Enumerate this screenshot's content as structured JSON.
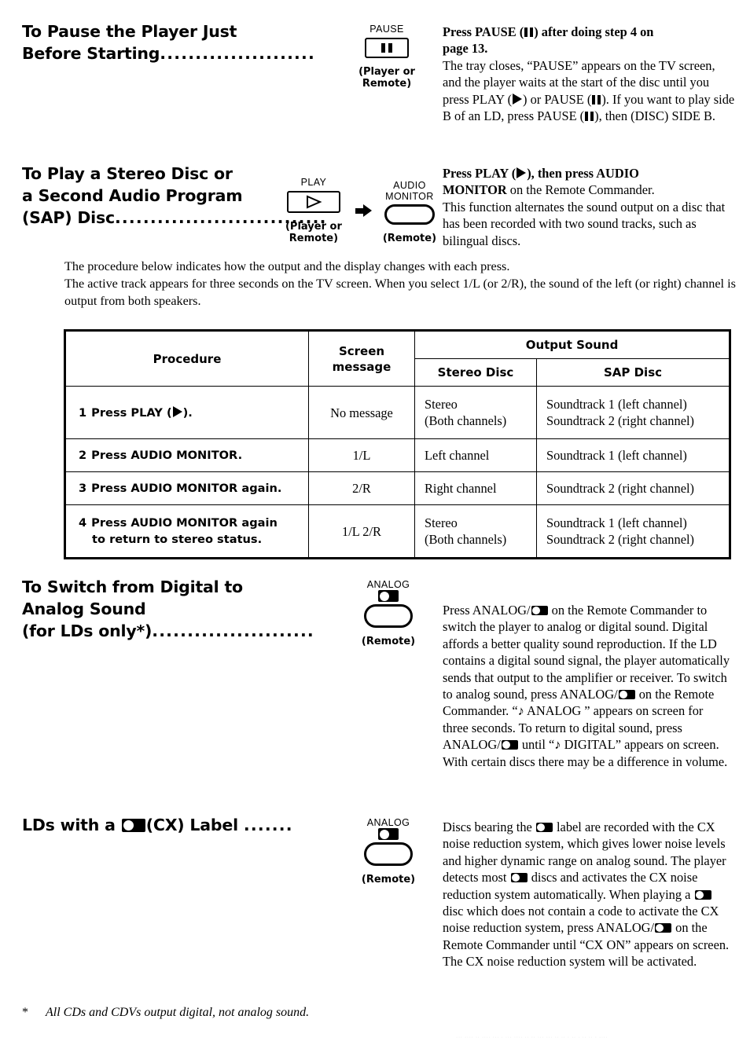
{
  "document": {
    "type": "instruction-manual-page",
    "footnote": {
      "marker": "*",
      "text": "All CDs and CDVs output digital, not analog sound."
    },
    "bottom_artifact": "··· ···· ·· ···· ··· · ··· ···· ·· ·· ··· ··· ·· ·· · ·· · ·· ·· · ····"
  },
  "sections": [
    {
      "id": "pause-before-start",
      "heading_line1": "To Pause the Player Just",
      "heading_line2": "Before Starting",
      "heading_dots": "......................",
      "icons": [
        {
          "label": "PAUSE",
          "glyph": "pause-glyph",
          "shape": "rect-button",
          "source": "(Player or Remote)"
        }
      ],
      "body_lead_line1": "Press PAUSE (Ⅱ) after doing step 4 on",
      "body_lead_line2": "page 13.",
      "body_text": "The tray closes, “PAUSE” appears on the TV screen, and the player waits at the start of the disc until you press PLAY (▶) or PAUSE (Ⅱ). If you want to play side B of an LD, press PAUSE (Ⅱ), then (DISC) SIDE B."
    },
    {
      "id": "stereo-or-sap-disc",
      "heading_line1": "To Play a Stereo Disc or",
      "heading_line2": "a Second Audio Program",
      "heading_line3": "(SAP) Disc",
      "heading_dots": "..............................",
      "icons": [
        {
          "label": "PLAY",
          "glyph": "play-triangle-outline",
          "shape": "rect-button",
          "source": "(Player or Remote)"
        },
        {
          "label_line1": "AUDIO",
          "label_line2": "MONITOR",
          "glyph": "none",
          "shape": "pill-button",
          "source": "(Remote)"
        }
      ],
      "body_lead_line1": "Press PLAY (▶), then press AUDIO",
      "body_lead_line2_bold": "MONITOR",
      "body_lead_line2_rest": " on the Remote Commander.",
      "body_text": "This function alternates the sound output on a disc that has been recorded with two sound tracks, such as bilingual discs."
    },
    {
      "id": "digital-to-analog",
      "heading_line1": "To Switch from Digital to",
      "heading_line2": "Analog Sound",
      "heading_line3": "(for LDs only*)",
      "heading_dots": ".......................",
      "icons": [
        {
          "label": "ANALOG",
          "glyph": "cx-logo",
          "shape": "pill-button",
          "source": "(Remote)"
        }
      ],
      "body_text_parts": [
        "Press ANALOG/",
        " on the Remote Commander to switch the player to analog or digital sound. Digital affords a better quality sound reproduction. If the LD contains a digital sound signal, the player automatically sends that output to the amplifier or receiver. To switch to analog sound, press ANALOG/",
        " on the Remote Commander. “♪ ANALOG ” appears on screen for three seconds. To return to digital sound, press ANALOG/",
        " until “♪ DIGITAL” appears on screen. With certain discs there may be a difference in volume."
      ]
    },
    {
      "id": "cx-label-lds",
      "heading_pre": "LDs with a ",
      "heading_post": "(CX) Label ",
      "heading_dots": ".......",
      "icons": [
        {
          "label": "ANALOG",
          "glyph": "cx-logo",
          "shape": "pill-button",
          "source": "(Remote)"
        }
      ],
      "body_text_parts": [
        "Discs bearing the ",
        " label are recorded with the CX noise reduction system, which gives lower noise levels and higher dynamic range on analog sound. The player detects most ",
        " discs and activates the CX noise reduction system automatically. When playing a ",
        " disc which does not contain a code to activate the CX noise reduction system, press ANALOG/",
        " on the Remote Commander until “CX ON” appears on screen. The CX noise reduction system will be activated."
      ]
    }
  ],
  "intro_paragraph": {
    "line1": "The procedure below indicates how the output and the display changes with each press.",
    "line2": "The active track appears for three seconds on the TV screen. When you select 1/L (or 2/R), the sound of the left (or right) channel is output from both speakers."
  },
  "chart_data": {
    "type": "table",
    "title": "",
    "headers_top": [
      "Procedure",
      "Screen message",
      "Output Sound"
    ],
    "headers_sub": [
      "Stereo Disc",
      "SAP Disc"
    ],
    "columns": [
      "Procedure",
      "Screen message",
      "Stereo Disc",
      "SAP Disc"
    ],
    "rows": [
      {
        "num": "1",
        "procedure": "Press PLAY (▶).",
        "procedure_line2": "",
        "screen_message": "No message",
        "stereo_disc_line1": "Stereo",
        "stereo_disc_line2": "(Both channels)",
        "sap_disc_line1": "Soundtrack 1 (left channel)",
        "sap_disc_line2": "Soundtrack 2 (right channel)"
      },
      {
        "num": "2",
        "procedure": "Press AUDIO MONITOR.",
        "procedure_line2": "",
        "screen_message": "1/L",
        "stereo_disc_line1": "Left channel",
        "stereo_disc_line2": "",
        "sap_disc_line1": "Soundtrack 1 (left channel)",
        "sap_disc_line2": ""
      },
      {
        "num": "3",
        "procedure": "Press AUDIO MONITOR again.",
        "procedure_line2": "",
        "screen_message": "2/R",
        "stereo_disc_line1": "Right channel",
        "stereo_disc_line2": "",
        "sap_disc_line1": "Soundtrack 2 (right channel)",
        "sap_disc_line2": ""
      },
      {
        "num": "4",
        "procedure": "Press AUDIO MONITOR again",
        "procedure_line2": "to return to stereo status.",
        "screen_message": "1/L  2/R",
        "stereo_disc_line1": "Stereo",
        "stereo_disc_line2": "(Both channels)",
        "sap_disc_line1": "Soundtrack 1 (left channel)",
        "sap_disc_line2": "Soundtrack 2 (right channel)"
      }
    ]
  },
  "colors": {
    "ink": "#000000",
    "paper": "#ffffff"
  }
}
